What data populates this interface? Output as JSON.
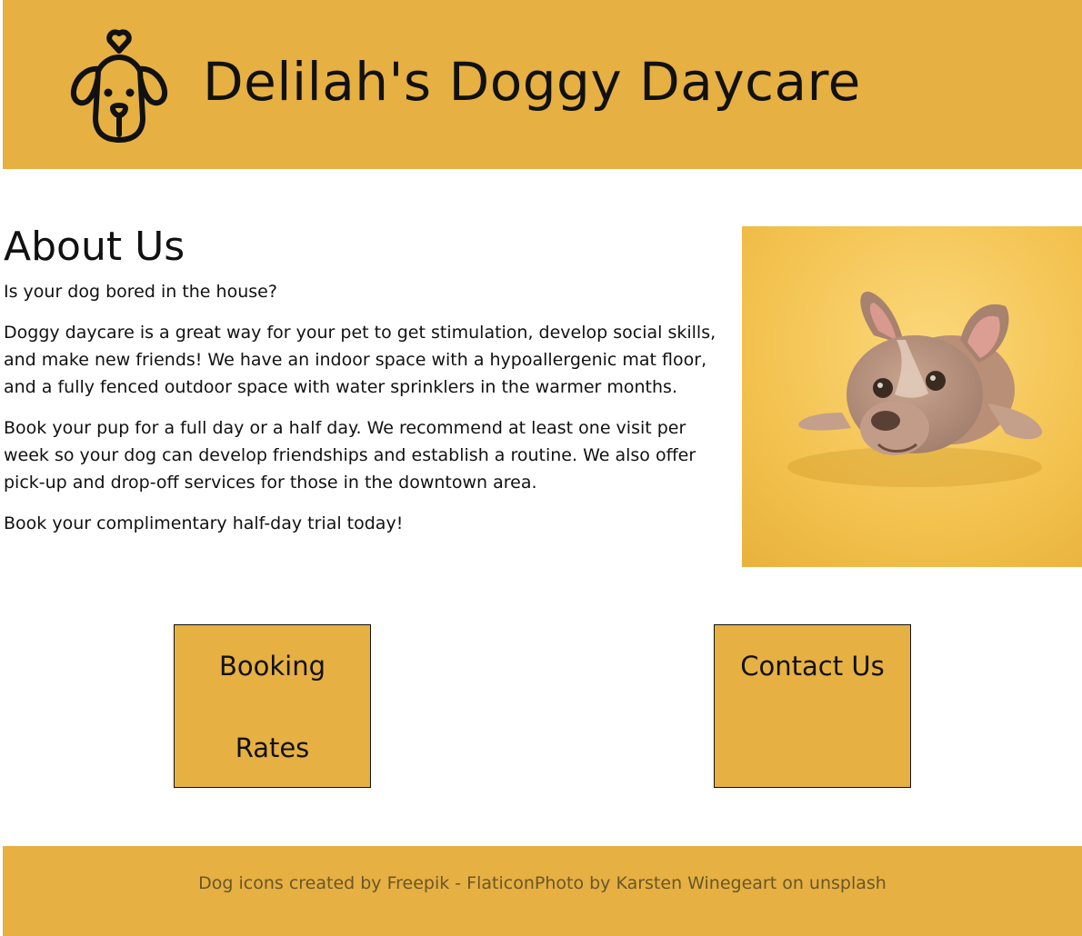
{
  "header": {
    "title": "Delilah's Doggy Daycare",
    "logo_icon": "dog-face-icon",
    "background": "#e6b042"
  },
  "about": {
    "heading": "About Us",
    "paragraphs": [
      "Is your dog bored in the house?",
      "Doggy daycare is a great way for your pet to get stimulation, develop social skills, and make new friends! We have an indoor space with a hypoallergenic mat floor, and a fully fenced outdoor space with water sprinklers in the warmer months.",
      "Book your pup for a full day or a half day. We recommend at least one visit per week so your dog can develop friendships and establish a routine. We also offer pick-up and drop-off services for those in the downtown area.",
      "Book your complimentary half-day trial today!"
    ],
    "photo": "french-bulldog-puppy-on-yellow-background"
  },
  "cards": {
    "booking": {
      "line1": "Booking",
      "line2": "Rates"
    },
    "contact": {
      "label": "Contact Us"
    }
  },
  "footer": {
    "credit": "Dog icons created by Freepik - FlaticonPhoto by Karsten Winegeart on unsplash"
  },
  "colors": {
    "accent": "#e6b042",
    "text": "#111111"
  }
}
